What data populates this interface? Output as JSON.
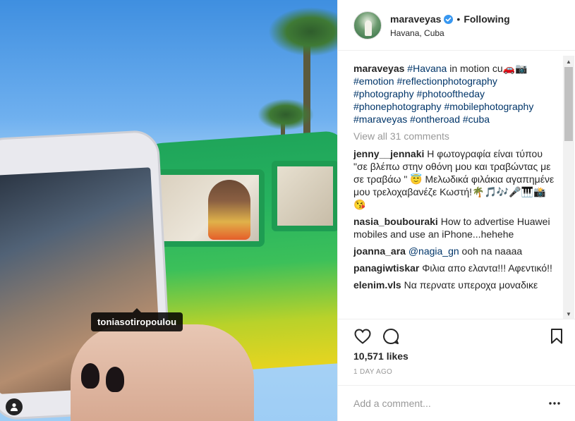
{
  "photo": {
    "tagged_user": "toniasotiropoulou",
    "user_tag_icon": "user-tag-icon"
  },
  "header": {
    "username": "maraveyas",
    "separator": "•",
    "follow_status": "Following",
    "location": "Havana, Cuba",
    "verified_icon": "verified-badge-icon"
  },
  "caption": {
    "username": "maraveyas",
    "parts": [
      {
        "type": "hash",
        "text": "#Havana"
      },
      {
        "type": "text",
        "text": " in motion cu🚗📷 "
      },
      {
        "type": "hash",
        "text": "#emotion"
      },
      {
        "type": "text",
        "text": " "
      },
      {
        "type": "hash",
        "text": "#reflectionphotography"
      },
      {
        "type": "text",
        "text": " "
      },
      {
        "type": "hash",
        "text": "#photography"
      },
      {
        "type": "text",
        "text": " "
      },
      {
        "type": "hash",
        "text": "#photooftheday"
      },
      {
        "type": "text",
        "text": " "
      },
      {
        "type": "hash",
        "text": "#phonephotography"
      },
      {
        "type": "text",
        "text": " "
      },
      {
        "type": "hash",
        "text": "#mobilephotography"
      },
      {
        "type": "text",
        "text": " "
      },
      {
        "type": "hash",
        "text": "#maraveyas"
      },
      {
        "type": "text",
        "text": " "
      },
      {
        "type": "hash",
        "text": "#ontheroad"
      },
      {
        "type": "text",
        "text": " "
      },
      {
        "type": "hash",
        "text": "#cuba"
      }
    ]
  },
  "view_all_comments": "View all 31 comments",
  "comments": [
    {
      "user": "jenny__jennaki",
      "parts": [
        {
          "type": "text",
          "text": "Η φωτογραφία είναι τύπου \"σε βλέπω στην οθόνη μου και τραβώντας με σε τραβάω \" 😇 Μελωδικά φιλάκια αγαπημένε μου τρελοχαβανέζε Κωστή!🌴🎵🎶🎤🎹📸😘"
        }
      ]
    },
    {
      "user": "nasia_boubouraki",
      "parts": [
        {
          "type": "text",
          "text": "How to advertise Huawei mobiles and use an iPhone...hehehe"
        }
      ]
    },
    {
      "user": "joanna_ara",
      "parts": [
        {
          "type": "mention",
          "text": "@nagia_gn"
        },
        {
          "type": "text",
          "text": " ooh na naaaa"
        }
      ]
    },
    {
      "user": "panagiwtiskar",
      "parts": [
        {
          "type": "text",
          "text": "Φιλια απο ελαντα!!! Αφεντικό!!"
        }
      ]
    },
    {
      "user": "elenim.vls",
      "parts": [
        {
          "type": "text",
          "text": "Να περνατε υπεροχα μοναδικε"
        }
      ]
    }
  ],
  "actions": {
    "like_icon": "heart-icon",
    "comment_icon": "comment-bubble-icon",
    "save_icon": "bookmark-icon",
    "likes": "10,571 likes",
    "time": "1 DAY AGO"
  },
  "add_comment": {
    "placeholder": "Add a comment...",
    "more_icon": "more-options-icon"
  },
  "colors": {
    "link": "#003569",
    "muted": "#999999",
    "text": "#262626",
    "verified": "#3897f0"
  }
}
